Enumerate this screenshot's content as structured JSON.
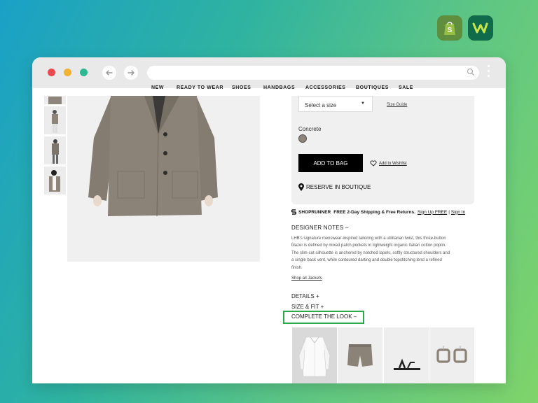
{
  "app_logos": [
    {
      "name": "shopify",
      "icon": "shopify-bag-icon",
      "color": "#5e8e3e"
    },
    {
      "name": "w-app",
      "icon": "w-letter-icon",
      "color": "#0f6b4a"
    }
  ],
  "browser": {
    "url": ""
  },
  "site_nav": {
    "items": [
      "NEW",
      "READY TO WEAR",
      "SHOES",
      "HANDBAGS",
      "ACCESSORIES",
      "BOUTIQUES",
      "SALE"
    ]
  },
  "product": {
    "size_select": "Select a size",
    "size_guide": "Size Guide",
    "color_label": "Concrete",
    "color_swatch": "#8e857a",
    "add_to_bag": "ADD TO BAG",
    "add_to_wishlist": "Add to Wishlist",
    "reserve": "RESERVE IN BOUTIQUE"
  },
  "shoprunner": {
    "brand": "SHOPRUNNER",
    "message": "FREE 2-Day Shipping & Free Returns.",
    "signup": "Sign Up FREE",
    "separator": "|",
    "signin": "Sign In"
  },
  "designer_notes": {
    "title": "DESIGNER NOTES –",
    "body": "LHB's signature menswear-inspired tailoring with a utilitarian twist, this three-button blazer is defined by mixed patch pockets in lightweight organic Italian cotton poplin. The slim-cut silhouette is anchored by notched lapels, softly structured shoulders and a single back vent, while contoured darting and double topstitching lend a refined finish.",
    "shop_all": "Shop all Jackets"
  },
  "sections": {
    "details": "DETAILS +",
    "size_fit": "SIZE & FIT +",
    "complete_the_look": "COMPLETE THE LOOK –"
  },
  "colors": {
    "highlight": "#2aa84a",
    "button": "#000000"
  }
}
